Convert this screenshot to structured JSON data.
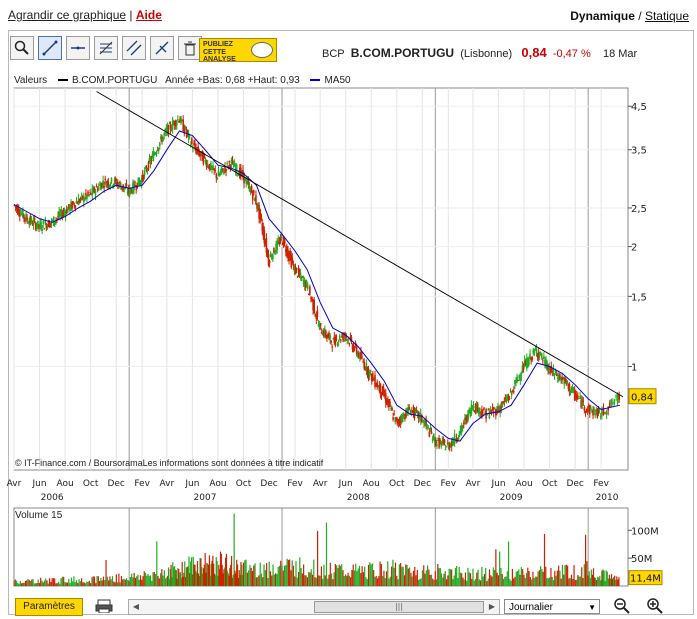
{
  "header": {
    "enlarge_link": "Agrandir ce graphique",
    "separator": "|",
    "help_link": "Aide",
    "mode_dynamic": "Dynamique",
    "mode_sep": " / ",
    "mode_static": "Statique"
  },
  "toolbar": {
    "buttons": [
      "zoom-icon",
      "trend-line-icon",
      "horizontal-line-icon",
      "fibonacci-icon",
      "channel-icon",
      "parallel-line-icon",
      "trash-icon"
    ],
    "publiez": [
      "PUBLIEZ",
      "CETTE",
      "ANALYSE"
    ]
  },
  "quote": {
    "ticker": "BCP",
    "name": "B.COM.PORTUGU",
    "exchange": "(Lisbonne)",
    "price": "0,84",
    "change": "-0,47 %",
    "date": "18 Mar"
  },
  "legend": {
    "label": "Valeurs",
    "series_name": "B.COM.PORTUGU",
    "range_text": "Année +Bas: 0,68 +Haut: 0,93",
    "ma_name": "MA50",
    "series_color": "#000000",
    "ma_color": "#0000cc"
  },
  "credit": "© IT-Finance.com / BoursoramaLes informations sont données à titre indicatif",
  "volume_label": "Volume 15",
  "bottom": {
    "params_button": "Paramètres",
    "period_select": "Journalier"
  },
  "colors": {
    "up": "#22aa22",
    "down": "#cc2200",
    "ma": "#0000cc",
    "badge": "#ffd700"
  },
  "chart_data": {
    "type": "line",
    "title": "B.COM.PORTUGU",
    "y_scale": "log",
    "ylim": [
      0.55,
      5.0
    ],
    "x_range": [
      "2006-04-01",
      "2010-03-18"
    ],
    "y_ticks": [
      "4,5",
      "3,5",
      "2,5",
      "2",
      "1,5",
      "1"
    ],
    "y_tick_values": [
      4.5,
      3.5,
      2.5,
      2.0,
      1.5,
      1.0
    ],
    "last_price_label": "0,84",
    "last_price": 0.84,
    "month_ticks": [
      "Avr",
      "Jun",
      "Aou",
      "Oct",
      "Dec",
      "Fev",
      "Avr",
      "Jun",
      "Aou",
      "Oct",
      "Dec",
      "Fev",
      "Avr",
      "Jun",
      "Aou",
      "Oct",
      "Dec",
      "Fev",
      "Avr",
      "Jun",
      "Aou",
      "Oct",
      "Dec",
      "Fev"
    ],
    "month_tick_dates": [
      "2006-04-01",
      "2006-06-01",
      "2006-08-01",
      "2006-10-01",
      "2006-12-01",
      "2007-02-01",
      "2007-04-01",
      "2007-06-01",
      "2007-08-01",
      "2007-10-01",
      "2007-12-01",
      "2008-02-01",
      "2008-04-01",
      "2008-06-01",
      "2008-08-01",
      "2008-10-01",
      "2008-12-01",
      "2009-02-01",
      "2009-04-01",
      "2009-06-01",
      "2009-08-01",
      "2009-10-01",
      "2009-12-01",
      "2010-02-01"
    ],
    "year_labels": [
      "2006",
      "2007",
      "2008",
      "2009",
      "2010"
    ],
    "year_label_dates": [
      "2006-07-01",
      "2007-07-01",
      "2008-07-01",
      "2009-07-01",
      "2010-02-15"
    ],
    "year_dividers": [
      "2007-01-01",
      "2008-01-01",
      "2009-01-01",
      "2010-01-01"
    ],
    "series": [
      {
        "name": "B.COM.PORTUGU",
        "x": [
          "2006-04-01",
          "2006-05-01",
          "2006-06-01",
          "2006-07-01",
          "2006-08-01",
          "2006-09-01",
          "2006-10-01",
          "2006-11-01",
          "2006-12-01",
          "2007-01-01",
          "2007-02-01",
          "2007-03-01",
          "2007-04-01",
          "2007-05-01",
          "2007-06-01",
          "2007-07-01",
          "2007-08-01",
          "2007-09-01",
          "2007-10-01",
          "2007-11-01",
          "2007-12-01",
          "2008-01-01",
          "2008-02-01",
          "2008-03-01",
          "2008-04-01",
          "2008-05-01",
          "2008-06-01",
          "2008-07-01",
          "2008-08-01",
          "2008-09-01",
          "2008-10-01",
          "2008-11-01",
          "2008-12-01",
          "2009-01-01",
          "2009-02-01",
          "2009-03-01",
          "2009-04-01",
          "2009-05-01",
          "2009-06-01",
          "2009-07-01",
          "2009-08-01",
          "2009-09-01",
          "2009-10-01",
          "2009-11-01",
          "2009-12-01",
          "2010-01-01",
          "2010-02-01",
          "2010-03-18"
        ],
        "values": [
          2.55,
          2.35,
          2.25,
          2.3,
          2.45,
          2.6,
          2.7,
          2.9,
          2.9,
          2.75,
          2.95,
          3.4,
          3.9,
          4.2,
          3.6,
          3.3,
          3.0,
          3.25,
          3.0,
          2.6,
          1.85,
          2.1,
          1.75,
          1.6,
          1.25,
          1.15,
          1.2,
          1.08,
          0.95,
          0.85,
          0.72,
          0.78,
          0.74,
          0.65,
          0.63,
          0.68,
          0.8,
          0.76,
          0.78,
          0.85,
          1.0,
          1.1,
          0.98,
          0.93,
          0.85,
          0.78,
          0.76,
          0.84
        ]
      },
      {
        "name": "MA50",
        "x": [
          "2006-04-01",
          "2006-05-01",
          "2006-06-01",
          "2006-07-01",
          "2006-08-01",
          "2006-09-01",
          "2006-10-01",
          "2006-11-01",
          "2006-12-01",
          "2007-01-01",
          "2007-02-01",
          "2007-03-01",
          "2007-04-01",
          "2007-05-01",
          "2007-06-01",
          "2007-07-01",
          "2007-08-01",
          "2007-09-01",
          "2007-10-01",
          "2007-11-01",
          "2007-12-01",
          "2008-01-01",
          "2008-02-01",
          "2008-03-01",
          "2008-04-01",
          "2008-05-01",
          "2008-06-01",
          "2008-07-01",
          "2008-08-01",
          "2008-09-01",
          "2008-10-01",
          "2008-11-01",
          "2008-12-01",
          "2009-01-01",
          "2009-02-01",
          "2009-03-01",
          "2009-04-01",
          "2009-05-01",
          "2009-06-01",
          "2009-07-01",
          "2009-08-01",
          "2009-09-01",
          "2009-10-01",
          "2009-11-01",
          "2009-12-01",
          "2010-01-01",
          "2010-02-01",
          "2010-03-18"
        ],
        "values": [
          2.55,
          2.45,
          2.35,
          2.3,
          2.38,
          2.5,
          2.6,
          2.75,
          2.85,
          2.8,
          2.85,
          3.1,
          3.5,
          3.9,
          3.8,
          3.5,
          3.2,
          3.15,
          3.05,
          2.85,
          2.35,
          2.15,
          1.95,
          1.75,
          1.45,
          1.25,
          1.2,
          1.12,
          1.02,
          0.92,
          0.8,
          0.76,
          0.75,
          0.7,
          0.66,
          0.65,
          0.72,
          0.76,
          0.77,
          0.8,
          0.9,
          1.02,
          1.0,
          0.96,
          0.9,
          0.83,
          0.78,
          0.8
        ]
      }
    ],
    "trendline": {
      "x": [
        "2006-10-15",
        "2010-03-25"
      ],
      "values": [
        4.9,
        0.84
      ]
    },
    "volume": {
      "label": "Volume 15",
      "unit": "M",
      "ylim": [
        0,
        140
      ],
      "y_ticks": [
        "100M",
        "50M"
      ],
      "y_tick_values": [
        100,
        50
      ],
      "last_label": "11,4M",
      "last": 11.4,
      "x": [
        "2006-04-01",
        "2006-07-01",
        "2006-10-01",
        "2007-01-01",
        "2007-04-01",
        "2007-06-01",
        "2007-08-01",
        "2007-10-01",
        "2008-01-01",
        "2008-04-01",
        "2008-07-01",
        "2008-10-01",
        "2009-01-01",
        "2009-04-01",
        "2009-07-01",
        "2009-10-01",
        "2010-01-01",
        "2010-03-18"
      ],
      "values": [
        8,
        10,
        12,
        15,
        25,
        35,
        40,
        30,
        35,
        30,
        25,
        30,
        25,
        22,
        20,
        25,
        28,
        11.4
      ]
    }
  }
}
